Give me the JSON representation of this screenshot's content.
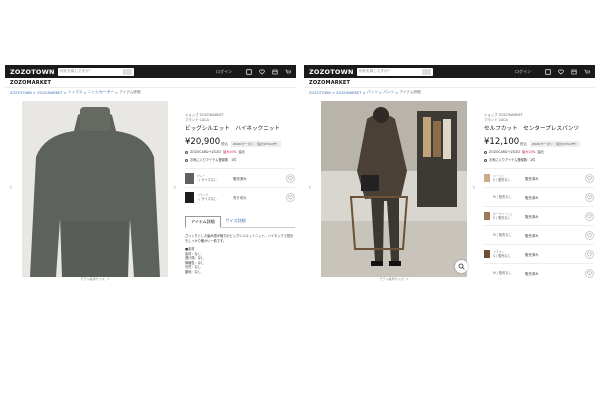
{
  "left": {
    "header": {
      "logo": "ZOZOTOWN",
      "search_placeholder": "何をお探しですか？",
      "login": "ログイン",
      "submark": "ZOZOMARKET"
    },
    "breadcrumb": [
      "ZOZOTOWN",
      "ZOZOMARKET",
      "トップス",
      "ニット/セーター",
      "アイテム詳細"
    ],
    "product": {
      "shop": "ショップ ZOZOMARKET",
      "brand": "ブランド CACA",
      "name": "ビッグシルエット　ハイネックニット",
      "price": "¥20,900",
      "tax": "税込",
      "coupon": "ZOZOクーポン\n（最大20%OFF）",
      "note1_prefix": "ZOZOCARD＋ZOZO",
      "note1_red": "最大10%",
      "note1_suffix": "還元",
      "note2": "お気に入りアイテム登録数：1件"
    },
    "variants": [
      {
        "color": "グレー",
        "name": "- / サイズなし",
        "status": "販売済み",
        "swatch": "#5e625c"
      },
      {
        "color": "ブラック",
        "name": "- / サイズなし",
        "status": "売り切れ",
        "swatch": "#1c1c1c"
      }
    ],
    "tabs": [
      "アイテム詳細",
      "サイズ詳細"
    ],
    "description": "ざっくりとした編み感が魅力のビッグシルエットニット。ハイネックで首元もしっかり暖かい一着です。",
    "specs": [
      "■素材",
      "素材：なし",
      "透け感：なし",
      "伸縮性：なし",
      "光沢：なし",
      "裏地：なし"
    ],
    "caption": "モデル着用サイズ：F",
    "thumb_colors": [
      "#777a74",
      "#3a3a3a",
      "#e6e0d6",
      "#cfcac1",
      "#4d4f4a",
      "#b7b9b3",
      "#565854",
      "#d8d4cc",
      "#2c2c2c",
      "#9a9c96"
    ]
  },
  "right": {
    "header": {
      "logo": "ZOZOTOWN",
      "search_placeholder": "何をお探しですか？",
      "login": "ログイン",
      "submark": "ZOZOMARKET"
    },
    "breadcrumb": [
      "ZOZOTOWN",
      "ZOZOMARKET",
      "パンツ",
      "パンツ",
      "アイテム詳細"
    ],
    "product": {
      "shop": "ショップ ZOZOMARKET",
      "brand": "ブランド CACA",
      "name": "セルフカット　センタープレスパンツ",
      "price": "¥12,100",
      "tax": "税込",
      "coupon": "ZOZOクーポン\n（最大20%OFF）",
      "note1_prefix": "ZOZOCARD＋ZOZO",
      "note1_red": "最大10%",
      "note1_suffix": "還元",
      "note2": "お気に入りアイテム登録数：1件"
    },
    "variants": [
      {
        "color": "ベージュ",
        "name": "S / 販売なし",
        "status": "販売済み",
        "swatch": "#c9ab88"
      },
      {
        "color": "",
        "name": "M / 販売なし",
        "status": "販売済み",
        "swatch": "#ffffff"
      },
      {
        "color": "ダークベージュ",
        "name": "S / 販売なし",
        "status": "販売済み",
        "swatch": "#9d7b58"
      },
      {
        "color": "",
        "name": "M / 販売なし",
        "status": "販売済み",
        "swatch": "#ffffff"
      },
      {
        "color": "ブラウン",
        "name": "S / 販売なし",
        "status": "販売済み",
        "swatch": "#6e5038"
      },
      {
        "color": "",
        "name": "M / 販売なし",
        "status": "販売済み",
        "swatch": "#ffffff"
      }
    ],
    "caption": "モデル着用サイズ：S",
    "thumb_colors": [
      "#8a6c50",
      "#d1b492",
      "#a68663",
      "#c8ab88",
      "#3a3532",
      "#b59674",
      "#2f2a26",
      "#9b7d5e",
      "#d8c0a2",
      "#5f4b3b",
      "#ccb08e",
      "#e3d1b8"
    ]
  }
}
